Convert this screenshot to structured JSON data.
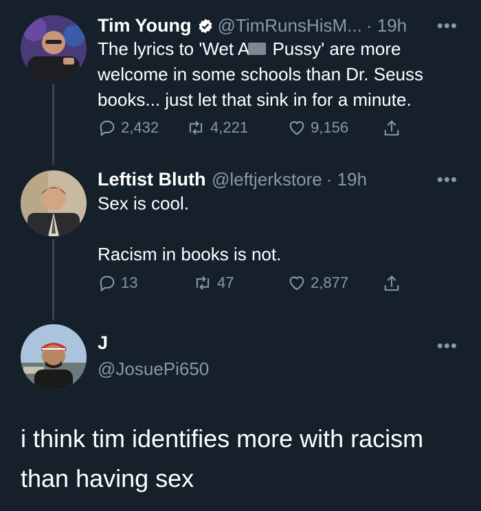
{
  "tweets": [
    {
      "name": "Tim Young",
      "handle": "@TimRunsHisM...",
      "time": "· 19h",
      "verified": true,
      "text_line1_a": "The lyrics to 'Wet A",
      "text_line1_b": " Pussy' are more",
      "text_line2": "welcome in some schools than Dr. Seuss",
      "text_line3": "books... just let that sink in for a minute.",
      "replies": "2,432",
      "retweets": "4,221",
      "likes": "9,156"
    },
    {
      "name": "Leftist Bluth",
      "handle": "@leftjerkstore",
      "time": "· 19h",
      "text_line1": "Sex is cool.",
      "text_line2": "Racism in books is not.",
      "replies": "13",
      "retweets": "47",
      "likes": "2,877"
    },
    {
      "name": "J",
      "handle": "@JosuePi650",
      "text_line1": "i think tim identifies more with racism",
      "text_line2": "than having sex"
    }
  ],
  "more_label": "•••",
  "colors": {
    "background": "#15202b",
    "muted": "#8899a6",
    "verified": "#ffffff"
  }
}
